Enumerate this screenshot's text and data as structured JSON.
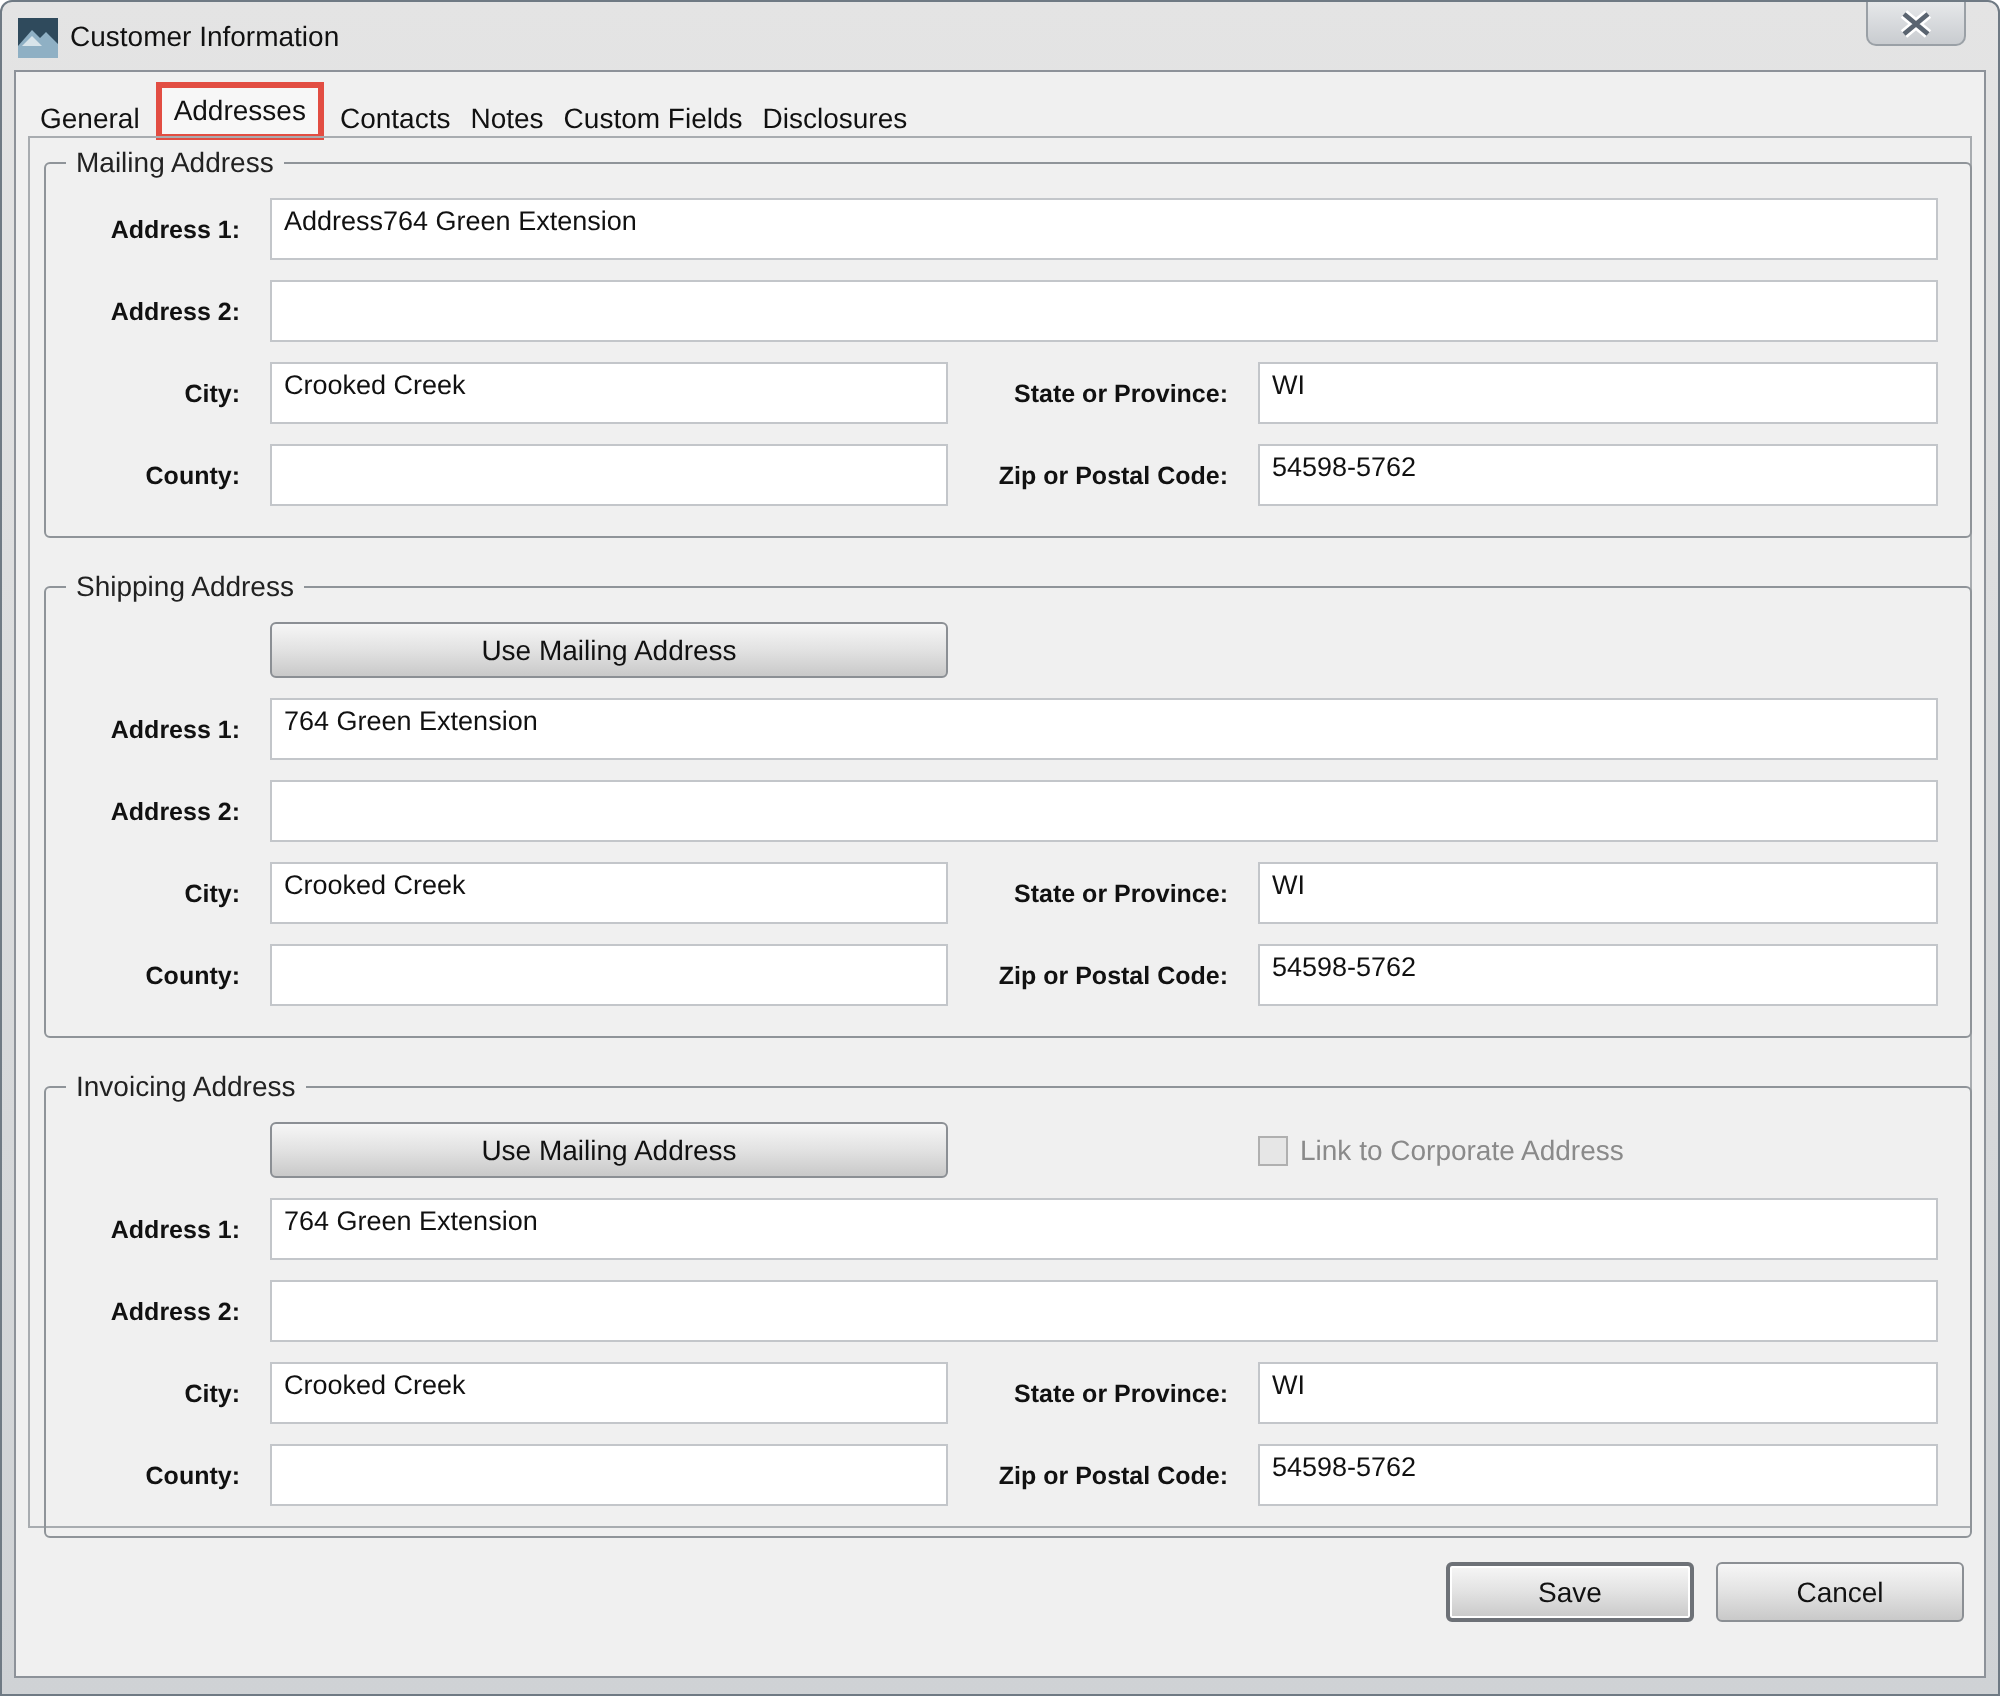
{
  "window": {
    "title": "Customer Information"
  },
  "tabs": [
    {
      "label": "General",
      "selected": false
    },
    {
      "label": "Addresses",
      "selected": true
    },
    {
      "label": "Contacts",
      "selected": false
    },
    {
      "label": "Notes",
      "selected": false
    },
    {
      "label": "Custom Fields",
      "selected": false
    },
    {
      "label": "Disclosures",
      "selected": false
    }
  ],
  "sections": [
    {
      "title": "Mailing Address",
      "rows": [
        {
          "kind": "full",
          "fields": [
            {
              "label": "Address 1:",
              "value": "Address764 Green Extension"
            }
          ]
        },
        {
          "kind": "full",
          "fields": [
            {
              "label": "Address 2:"
            }
          ]
        },
        {
          "kind": "half",
          "fields": [
            {
              "label": "City:",
              "value": "Crooked Creek"
            },
            {
              "label": "State or Province:",
              "value": "WI"
            }
          ]
        },
        {
          "kind": "half",
          "fields": [
            {
              "label": "County:"
            },
            {
              "label": "Zip or Postal Code:",
              "value": "54598-5762"
            }
          ]
        }
      ]
    },
    {
      "title": "Shipping Address",
      "button": "Use Mailing Address",
      "rows": [
        {
          "kind": "full",
          "fields": [
            {
              "label": "Address 1:",
              "value": "764 Green Extension"
            }
          ]
        },
        {
          "kind": "full",
          "fields": [
            {
              "label": "Address 2:"
            }
          ]
        },
        {
          "kind": "half",
          "fields": [
            {
              "label": "City:",
              "value": "Crooked Creek"
            },
            {
              "label": "State or Province:",
              "value": "WI"
            }
          ]
        },
        {
          "kind": "half",
          "fields": [
            {
              "label": "County:"
            },
            {
              "label": "Zip or Postal Code:",
              "value": "54598-5762"
            }
          ]
        }
      ]
    },
    {
      "title": "Invoicing Address",
      "button": "Use Mailing Address",
      "checkbox": {
        "label": "Link to Corporate Address",
        "checked": false,
        "disabled": true
      },
      "rows": [
        {
          "kind": "full",
          "fields": [
            {
              "label": "Address 1:",
              "value": "764 Green Extension"
            }
          ]
        },
        {
          "kind": "full",
          "fields": [
            {
              "label": "Address 2:"
            }
          ]
        },
        {
          "kind": "half",
          "fields": [
            {
              "label": "City:",
              "value": "Crooked Creek"
            },
            {
              "label": "State or Province:",
              "value": "WI"
            }
          ]
        },
        {
          "kind": "half",
          "fields": [
            {
              "label": "County:"
            },
            {
              "label": "Zip or Postal Code:",
              "value": "54598-5762"
            }
          ]
        }
      ]
    }
  ],
  "buttons": [
    {
      "label": "Save",
      "kind": "default"
    },
    {
      "label": "Cancel",
      "kind": "normal"
    }
  ]
}
